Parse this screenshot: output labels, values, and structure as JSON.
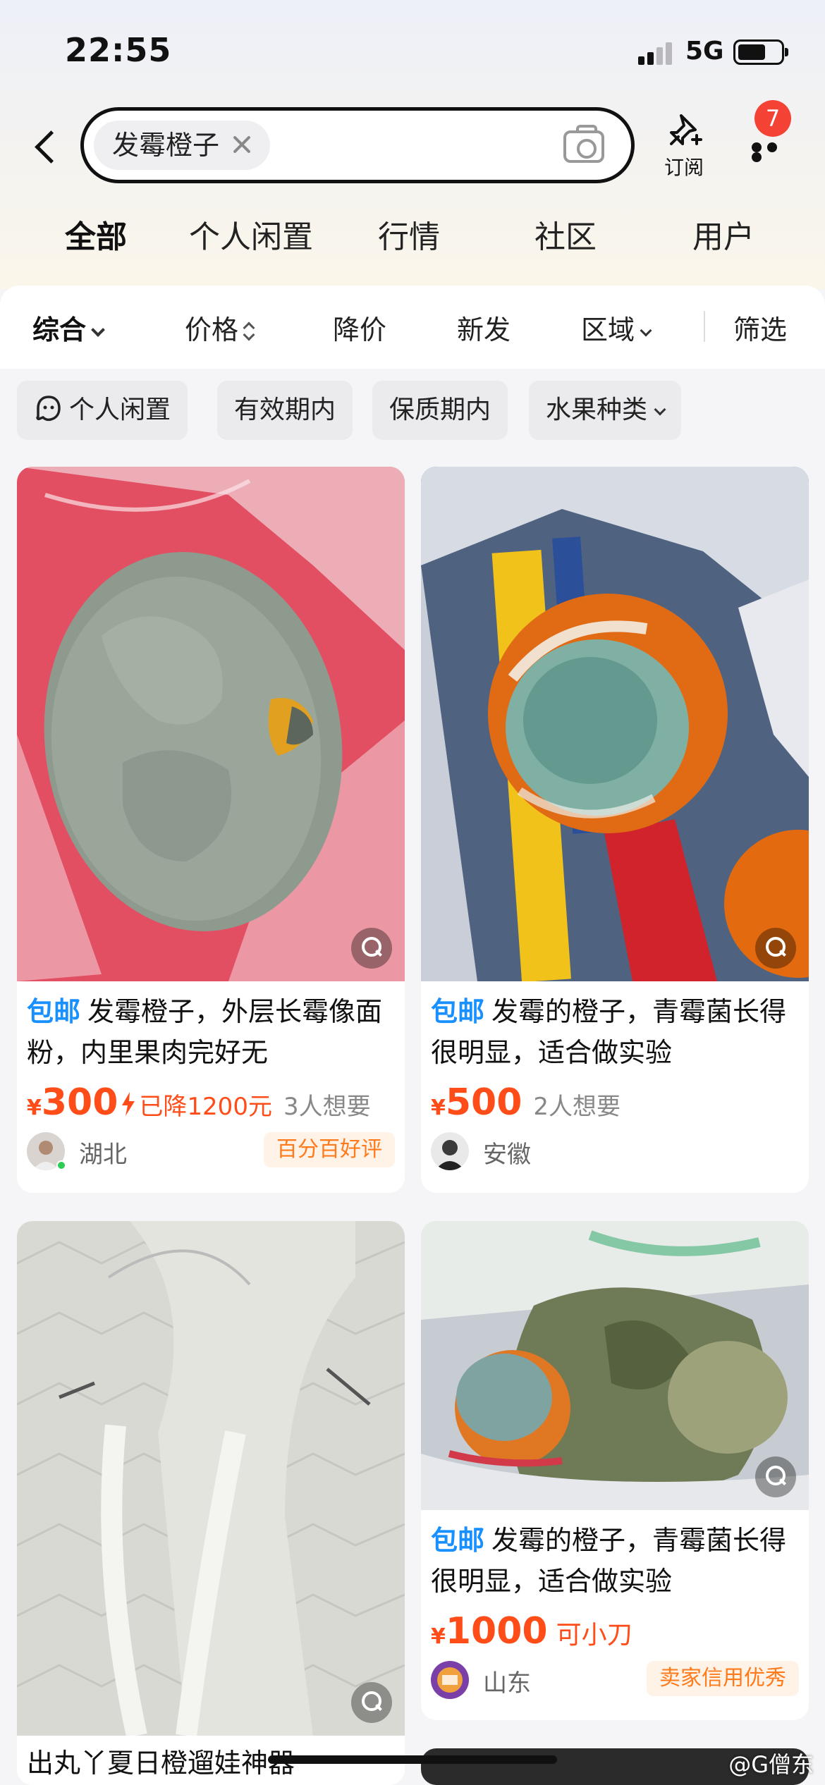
{
  "status_bar": {
    "time": "22:55",
    "network": "5G",
    "battery_level": 0.6
  },
  "search": {
    "query": "发霉橙子",
    "subscribe_label": "订阅",
    "notification_count": "7"
  },
  "tabs": [
    {
      "label": "全部",
      "active": true
    },
    {
      "label": "个人闲置"
    },
    {
      "label": "行情"
    },
    {
      "label": "社区"
    },
    {
      "label": "用户"
    }
  ],
  "sort": [
    "综合",
    "价格",
    "降价",
    "新发",
    "区域",
    "筛选"
  ],
  "filter_chips": [
    "个人闲置",
    "有效期内",
    "保质期内",
    "水果种类"
  ],
  "items": [
    {
      "tag": "包邮",
      "title": "发霉橙子，外层长霉像面粉，内里果肉完好无",
      "currency": "¥",
      "price": "300",
      "price_drop": "已降1200元",
      "want": "3人想要",
      "region": "湖北",
      "badge": "百分百好评"
    },
    {
      "tag": "包邮",
      "title": "发霉的橙子，青霉菌长得很明显，适合做实验",
      "currency": "¥",
      "price": "500",
      "want": "2人想要",
      "region": "安徽"
    },
    {
      "title": "出丸丫夏日橙遛娃神器"
    },
    {
      "tag": "包邮",
      "title": "发霉的橙子，青霉菌长得很明显，适合做实验",
      "currency": "¥",
      "price": "1000",
      "bargain": "可小刀",
      "region": "山东",
      "badge": "卖家信用优秀"
    }
  ],
  "watermark": "@G僧东",
  "icons": [
    "back-arrow-icon",
    "close-icon",
    "camera-icon",
    "pin-icon",
    "more-icon",
    "chevron-down-icon",
    "sort-updown-icon",
    "ghost-icon",
    "zoom-search-icon",
    "bolt-icon"
  ]
}
